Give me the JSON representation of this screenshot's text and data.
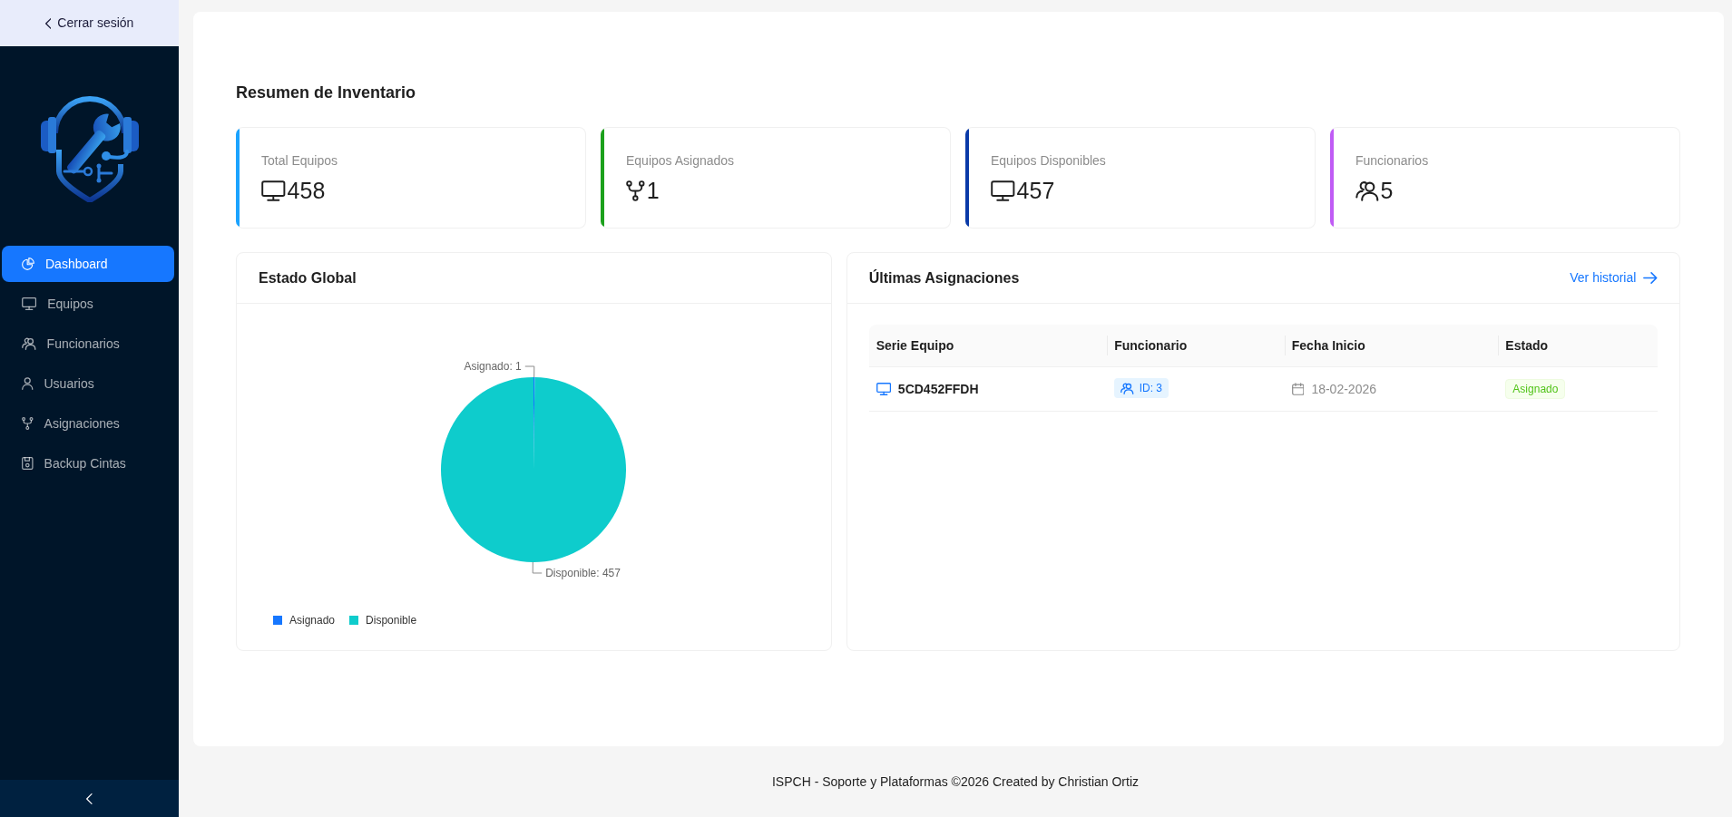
{
  "sidebar": {
    "logout": "Cerrar sesión",
    "items": [
      {
        "label": "Dashboard",
        "selected": true
      },
      {
        "label": "Equipos",
        "selected": false
      },
      {
        "label": "Funcionarios",
        "selected": false
      },
      {
        "label": "Usuarios",
        "selected": false
      },
      {
        "label": "Asignaciones",
        "selected": false
      },
      {
        "label": "Backup Cintas",
        "selected": false
      }
    ]
  },
  "page": {
    "title": "Resumen de Inventario"
  },
  "stats": [
    {
      "label": "Total Equipos",
      "value": "458",
      "color": "#1aa3ff"
    },
    {
      "label": "Equipos Asignados",
      "value": "1",
      "color": "#1ca11c"
    },
    {
      "label": "Equipos Disponibles",
      "value": "457",
      "color": "#0a3aa8"
    },
    {
      "label": "Funcionarios",
      "value": "5",
      "color": "#c05cf5"
    }
  ],
  "estado_global": {
    "title": "Estado Global",
    "chart_data": {
      "type": "pie",
      "categories": [
        "Asignado",
        "Disponible"
      ],
      "values": [
        1,
        457
      ],
      "colors": [
        "#1677ff",
        "#0ecccc"
      ],
      "value_labels": [
        "Asignado: 1",
        "Disponible: 457"
      ],
      "legend": "bottom-left"
    }
  },
  "ultimas_asignaciones": {
    "title": "Últimas Asignaciones",
    "link": "Ver historial",
    "table": {
      "columns": [
        "Serie Equipo",
        "Funcionario",
        "Fecha Inicio",
        "Estado"
      ],
      "rows": [
        {
          "serie_equipo": "5CD452FFDH",
          "funcionario": "ID: 3",
          "fecha_inicio": "18-02-2026",
          "estado": "Asignado"
        }
      ]
    }
  },
  "footer": "ISPCH - Soporte y Plataformas ©2026 Created by Christian Ortiz"
}
